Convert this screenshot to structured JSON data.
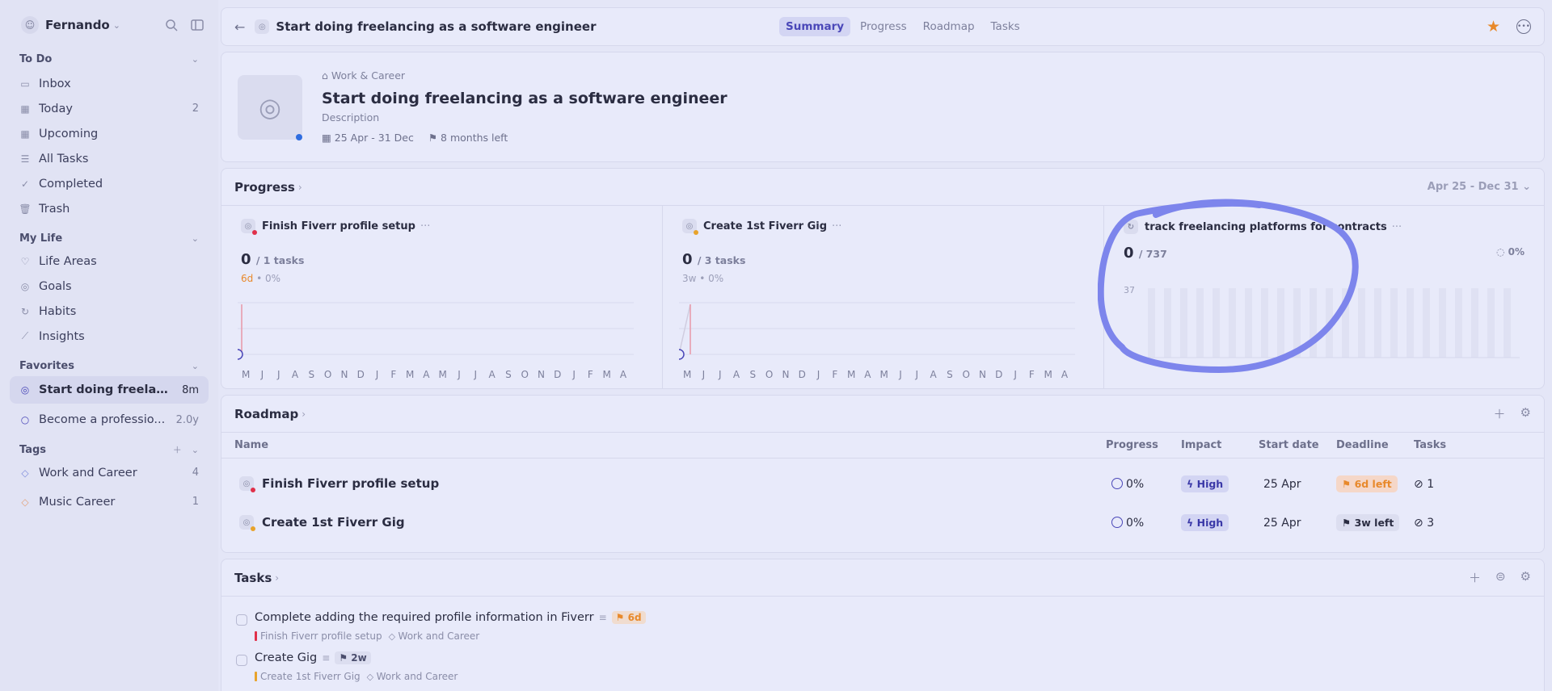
{
  "sidebar": {
    "user_name": "Fernando",
    "sections": {
      "todo": "To Do",
      "mylife": "My Life",
      "favorites": "Favorites",
      "tags": "Tags"
    },
    "todo_items": [
      {
        "label": "Inbox",
        "icon": "inbox-icon",
        "count": ""
      },
      {
        "label": "Today",
        "icon": "calendar-icon",
        "count": "2"
      },
      {
        "label": "Upcoming",
        "icon": "calendar-icon",
        "count": ""
      },
      {
        "label": "All Tasks",
        "icon": "list-icon",
        "count": ""
      },
      {
        "label": "Completed",
        "icon": "check-icon",
        "count": ""
      },
      {
        "label": "Trash",
        "icon": "trash-icon",
        "count": ""
      }
    ],
    "mylife_items": [
      {
        "label": "Life Areas",
        "icon": "heart-icon"
      },
      {
        "label": "Goals",
        "icon": "target-icon"
      },
      {
        "label": "Habits",
        "icon": "refresh-icon"
      },
      {
        "label": "Insights",
        "icon": "chart-icon"
      }
    ],
    "favorites": [
      {
        "label": "Start doing freelan...",
        "count": "8m"
      },
      {
        "label": "Become a professio...",
        "count": "2.0y"
      }
    ],
    "tags": [
      {
        "label": "Work and Career",
        "count": "4",
        "color": "#7f8ddc"
      },
      {
        "label": "Music Career",
        "count": "1",
        "color": "#e3a27a"
      }
    ]
  },
  "topbar": {
    "title": "Start doing freelancing as a software engineer",
    "tabs": [
      "Summary",
      "Progress",
      "Roadmap",
      "Tasks"
    ]
  },
  "goal": {
    "area": "Work & Career",
    "title": "Start doing freelancing as a software engineer",
    "description": "Description",
    "date_range": "25 Apr - 31 Dec",
    "time_left": "8 months left"
  },
  "progress": {
    "title": "Progress",
    "range": "Apr 25 - Dec 31",
    "months": [
      "M",
      "J",
      "J",
      "A",
      "S",
      "O",
      "N",
      "D",
      "J",
      "F",
      "M",
      "A",
      "M",
      "J",
      "J",
      "A",
      "S",
      "O",
      "N",
      "D",
      "J",
      "F",
      "M",
      "A"
    ],
    "panels": [
      {
        "title": "Finish Fiverr profile setup",
        "num": "0",
        "den": "/ 1 tasks",
        "due": "6d",
        "pct": "0%",
        "dot": "#e0304a"
      },
      {
        "title": "Create 1st Fiverr Gig",
        "num": "0",
        "den": "/ 3 tasks",
        "due": "3w",
        "pct": "0%",
        "dot": "#e8a32b"
      },
      {
        "title": "track freelancing platforms for contracts",
        "num": "0",
        "den": "/ 737",
        "pct": "0%",
        "ymax": "37"
      }
    ]
  },
  "roadmap": {
    "title": "Roadmap",
    "columns": [
      "Name",
      "Progress",
      "Impact",
      "Start date",
      "Deadline",
      "Tasks"
    ],
    "rows": [
      {
        "name": "Finish Fiverr profile setup",
        "progress": "0%",
        "impact": "High",
        "start": "25 Apr",
        "deadline": "6d left",
        "tasks": "1",
        "dot": "#e0304a"
      },
      {
        "name": "Create 1st Fiverr Gig",
        "progress": "0%",
        "impact": "High",
        "start": "25 Apr",
        "deadline": "3w left",
        "tasks": "3",
        "dot": "#e8a32b"
      }
    ]
  },
  "tasks": {
    "title": "Tasks",
    "items": [
      {
        "title": "Complete adding the required profile information in Fiverr",
        "badge": "6d",
        "goal": "Finish Fiverr profile setup",
        "goal_color": "#e0304a",
        "tag": "Work and Career"
      },
      {
        "title": "Create Gig",
        "badge": "2w",
        "goal": "Create 1st Fiverr Gig",
        "goal_color": "#e8a32b",
        "tag": "Work and Career"
      }
    ]
  }
}
